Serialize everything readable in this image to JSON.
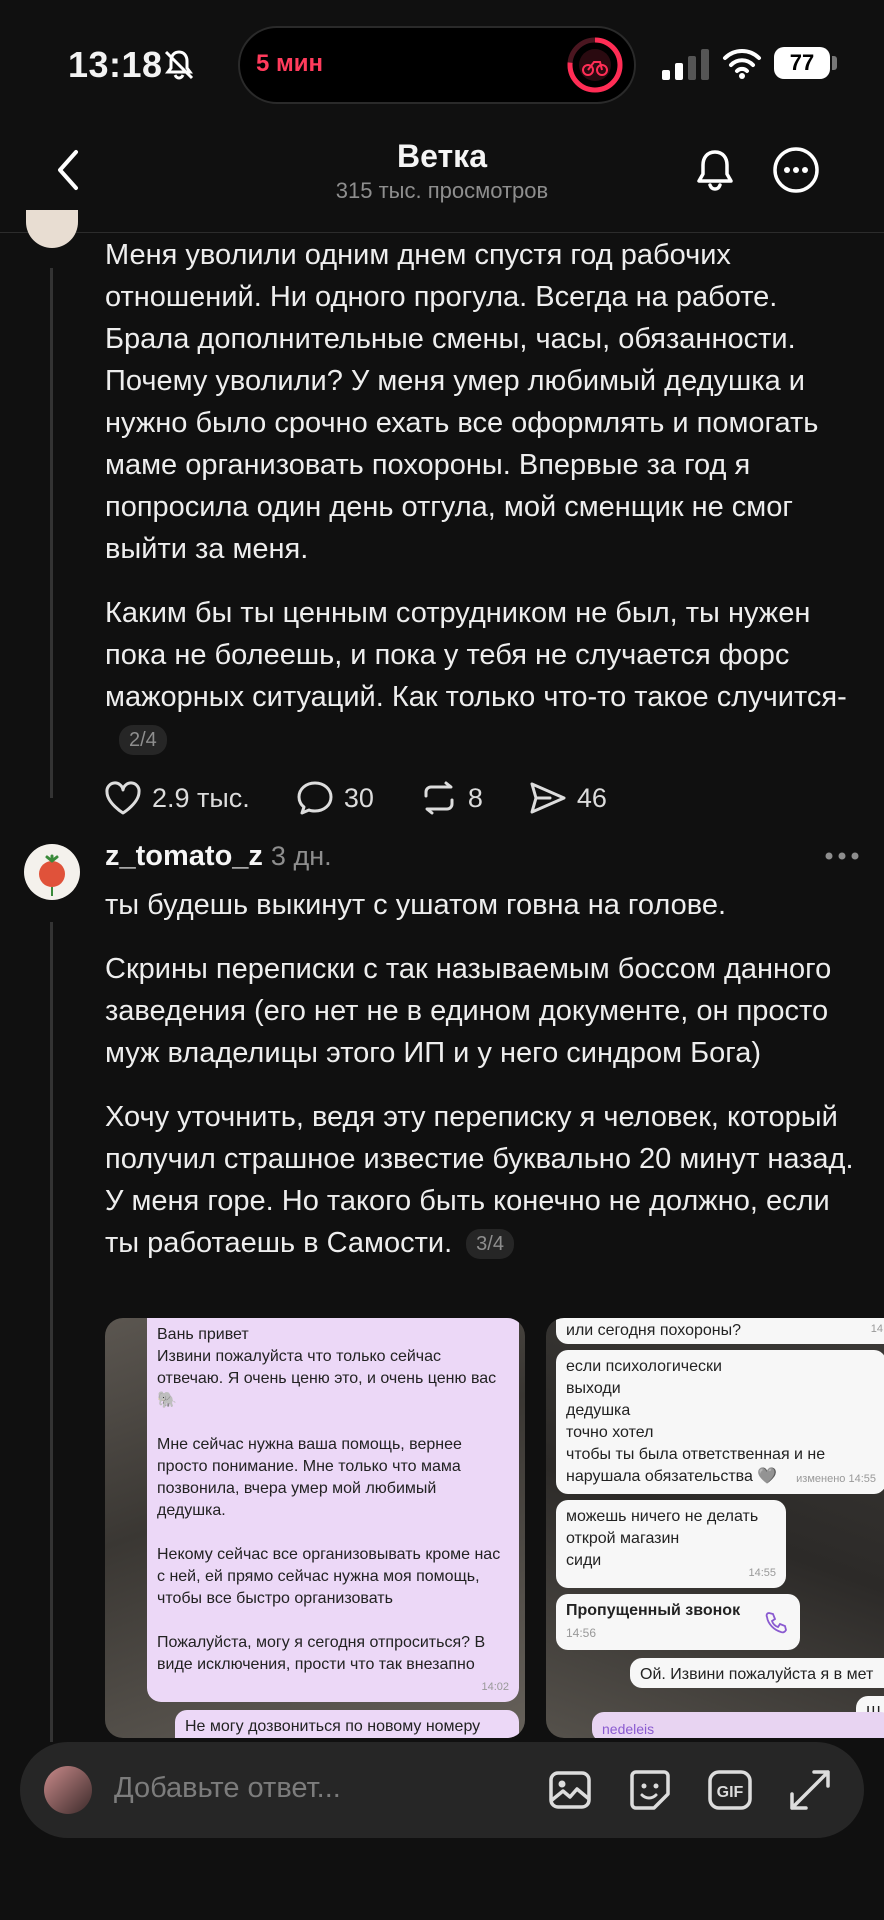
{
  "status_bar": {
    "time": "13:18",
    "island_text": "5 мин",
    "battery": "77"
  },
  "header": {
    "title": "Ветка",
    "subtitle": "315 тыс. просмотров"
  },
  "post1": {
    "paragraphs": [
      "Меня уволили одним днем спустя год рабочих отношений. Ни одного прогула. Всегда на работе. Брала дополнительные смены, часы, обязанности. Почему уволили? У меня умер любимый дедушка и нужно было срочно ехать все оформлять и помогать маме организовать похороны. Впервые за год я попросила один день отгула, мой сменщик не смог выйти за меня.",
      "Каким бы ты ценным сотрудником не был, ты нужен пока не болеешь, и пока у тебя не случается форс мажорных ситуаций. Как только что-то такое случится-"
    ],
    "counter": "2/4",
    "likes": "2.9 тыс.",
    "comments": "30",
    "reposts": "8",
    "shares": "46"
  },
  "post2": {
    "username": "z_tomato_z",
    "ago": "3 дн.",
    "paragraphs": [
      "ты будешь выкинут с ушатом говна на голове.",
      "Скрины переписки с так называемым боссом данного заведения (его нет не в едином документе, он просто муж владелицы этого ИП и у него синдром Бога)",
      "Хочу уточнить, ведя эту переписку я человек, который получил страшное известие буквально 20 минут назад. У меня горе. Но такого быть конечно не должно, если ты работаешь в Самости."
    ],
    "counter": "3/4"
  },
  "screenshot1": {
    "message1": "Вань привет\nИзвини пожалуйста что только сейчас отвечаю. Я очень ценю это, и очень ценю вас🐘\n\nМне сейчас нужна ваша помощь, вернее просто понимание. Мне только что мама позвонила, вчера умер мой любимый дедушка.\n\nНекому сейчас все организовывать кроме нас с ней, ей прямо сейчас нужна моя помощь, чтобы все быстро организовать\n\nПожалуйста, могу я сегодня отпроситься? В виде исключения, прости что так внезапно",
    "message1_time": "14:02",
    "message2": "Не могу дозвониться по новому номеру"
  },
  "screenshot2": {
    "msg_top": "или сегодня похороны?",
    "msg_top_time": "14:",
    "msg_a": "если психологически\nвыходи\nдедушка\nточно хотел\nчтобы ты была ответственная и не нарушала обязательства 🩶",
    "msg_a_time": "изменено 14:55",
    "msg_b": "можешь ничего не делать\nоткрой магазин\nсиди",
    "msg_b_time": "14:55",
    "missed_call": "Пропущенный звонок",
    "missed_time": "14:56",
    "reply": "Ой. Извини пожалуйста я в мет",
    "reply_short": "Ш",
    "nick": "nedeleis"
  },
  "reply_bar": {
    "placeholder": "Добавьте ответ..."
  }
}
